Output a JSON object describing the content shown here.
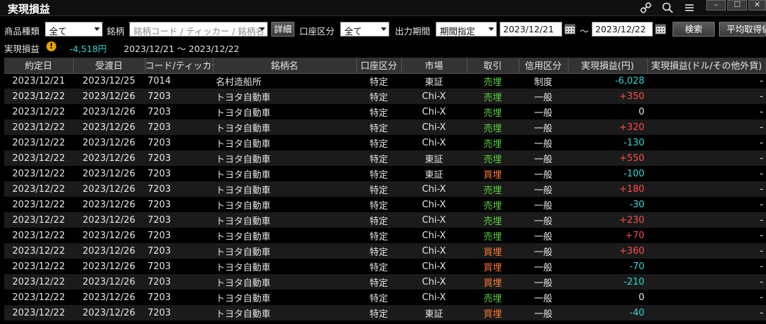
{
  "window": {
    "title": "実現損益",
    "win_minimize": "–",
    "win_maximize": "☐",
    "win_close": "✕"
  },
  "filters": {
    "product_type_label": "商品種類",
    "product_type_value": "全て",
    "symbol_label": "銘柄",
    "symbol_placeholder": "銘柄コード / ティッカー / 銘柄名",
    "detail_button": "詳細",
    "account_label": "口座区分",
    "account_value": "全て",
    "period_label": "出力期間",
    "period_value": "期間指定",
    "date_from": "2023/12/21",
    "date_sep": "～",
    "date_to": "2023/12/22",
    "search_button": "検索",
    "avg_button": "平均取得価"
  },
  "summary": {
    "label": "実現損益",
    "warn_icon": "!",
    "total": "-4,518円",
    "period_text": "2023/12/21 ～ 2023/12/22"
  },
  "colors": {
    "positive": "#ff4d4d",
    "negative": "#33d6d6",
    "sell": "#5ad13a",
    "buy": "#ff7a30"
  },
  "table": {
    "headers": [
      "約定日",
      "受渡日",
      "コード/ティッカー",
      "銘柄名",
      "口座区分",
      "市場",
      "取引",
      "信用区分",
      "実現損益(円)",
      "実現損益(ドル/その他外貨)"
    ],
    "rows": [
      {
        "trade_date": "2023/12/21",
        "settle_date": "2023/12/25",
        "code": "7014",
        "name": "名村造船所",
        "account": "特定",
        "market": "東証",
        "trade": "売埋",
        "margin": "制度",
        "pl_jpy": "-6,028",
        "pl_fx": "-"
      },
      {
        "trade_date": "2023/12/22",
        "settle_date": "2023/12/26",
        "code": "7203",
        "name": "トヨタ自動車",
        "account": "特定",
        "market": "Chi-X",
        "trade": "売埋",
        "margin": "一般",
        "pl_jpy": "+350",
        "pl_fx": "-"
      },
      {
        "trade_date": "2023/12/22",
        "settle_date": "2023/12/26",
        "code": "7203",
        "name": "トヨタ自動車",
        "account": "特定",
        "market": "Chi-X",
        "trade": "売埋",
        "margin": "一般",
        "pl_jpy": "0",
        "pl_fx": "-"
      },
      {
        "trade_date": "2023/12/22",
        "settle_date": "2023/12/26",
        "code": "7203",
        "name": "トヨタ自動車",
        "account": "特定",
        "market": "Chi-X",
        "trade": "売埋",
        "margin": "一般",
        "pl_jpy": "+320",
        "pl_fx": "-"
      },
      {
        "trade_date": "2023/12/22",
        "settle_date": "2023/12/26",
        "code": "7203",
        "name": "トヨタ自動車",
        "account": "特定",
        "market": "Chi-X",
        "trade": "売埋",
        "margin": "一般",
        "pl_jpy": "-130",
        "pl_fx": "-"
      },
      {
        "trade_date": "2023/12/22",
        "settle_date": "2023/12/26",
        "code": "7203",
        "name": "トヨタ自動車",
        "account": "特定",
        "market": "東証",
        "trade": "売埋",
        "margin": "一般",
        "pl_jpy": "+550",
        "pl_fx": "-"
      },
      {
        "trade_date": "2023/12/22",
        "settle_date": "2023/12/26",
        "code": "7203",
        "name": "トヨタ自動車",
        "account": "特定",
        "market": "東証",
        "trade": "買埋",
        "margin": "一般",
        "pl_jpy": "-100",
        "pl_fx": "-"
      },
      {
        "trade_date": "2023/12/22",
        "settle_date": "2023/12/26",
        "code": "7203",
        "name": "トヨタ自動車",
        "account": "特定",
        "market": "Chi-X",
        "trade": "売埋",
        "margin": "一般",
        "pl_jpy": "+180",
        "pl_fx": "-"
      },
      {
        "trade_date": "2023/12/22",
        "settle_date": "2023/12/26",
        "code": "7203",
        "name": "トヨタ自動車",
        "account": "特定",
        "market": "Chi-X",
        "trade": "売埋",
        "margin": "一般",
        "pl_jpy": "-30",
        "pl_fx": "-"
      },
      {
        "trade_date": "2023/12/22",
        "settle_date": "2023/12/26",
        "code": "7203",
        "name": "トヨタ自動車",
        "account": "特定",
        "market": "Chi-X",
        "trade": "売埋",
        "margin": "一般",
        "pl_jpy": "+230",
        "pl_fx": "-"
      },
      {
        "trade_date": "2023/12/22",
        "settle_date": "2023/12/26",
        "code": "7203",
        "name": "トヨタ自動車",
        "account": "特定",
        "market": "Chi-X",
        "trade": "売埋",
        "margin": "一般",
        "pl_jpy": "+70",
        "pl_fx": "-"
      },
      {
        "trade_date": "2023/12/22",
        "settle_date": "2023/12/26",
        "code": "7203",
        "name": "トヨタ自動車",
        "account": "特定",
        "market": "Chi-X",
        "trade": "買埋",
        "margin": "一般",
        "pl_jpy": "+360",
        "pl_fx": "-"
      },
      {
        "trade_date": "2023/12/22",
        "settle_date": "2023/12/26",
        "code": "7203",
        "name": "トヨタ自動車",
        "account": "特定",
        "market": "Chi-X",
        "trade": "買埋",
        "margin": "一般",
        "pl_jpy": "-70",
        "pl_fx": "-"
      },
      {
        "trade_date": "2023/12/22",
        "settle_date": "2023/12/26",
        "code": "7203",
        "name": "トヨタ自動車",
        "account": "特定",
        "market": "Chi-X",
        "trade": "買埋",
        "margin": "一般",
        "pl_jpy": "-210",
        "pl_fx": "-"
      },
      {
        "trade_date": "2023/12/22",
        "settle_date": "2023/12/26",
        "code": "7203",
        "name": "トヨタ自動車",
        "account": "特定",
        "market": "Chi-X",
        "trade": "売埋",
        "margin": "一般",
        "pl_jpy": "0",
        "pl_fx": "-"
      },
      {
        "trade_date": "2023/12/22",
        "settle_date": "2023/12/26",
        "code": "7203",
        "name": "トヨタ自動車",
        "account": "特定",
        "market": "東証",
        "trade": "買埋",
        "margin": "一般",
        "pl_jpy": "-40",
        "pl_fx": "-"
      }
    ]
  }
}
